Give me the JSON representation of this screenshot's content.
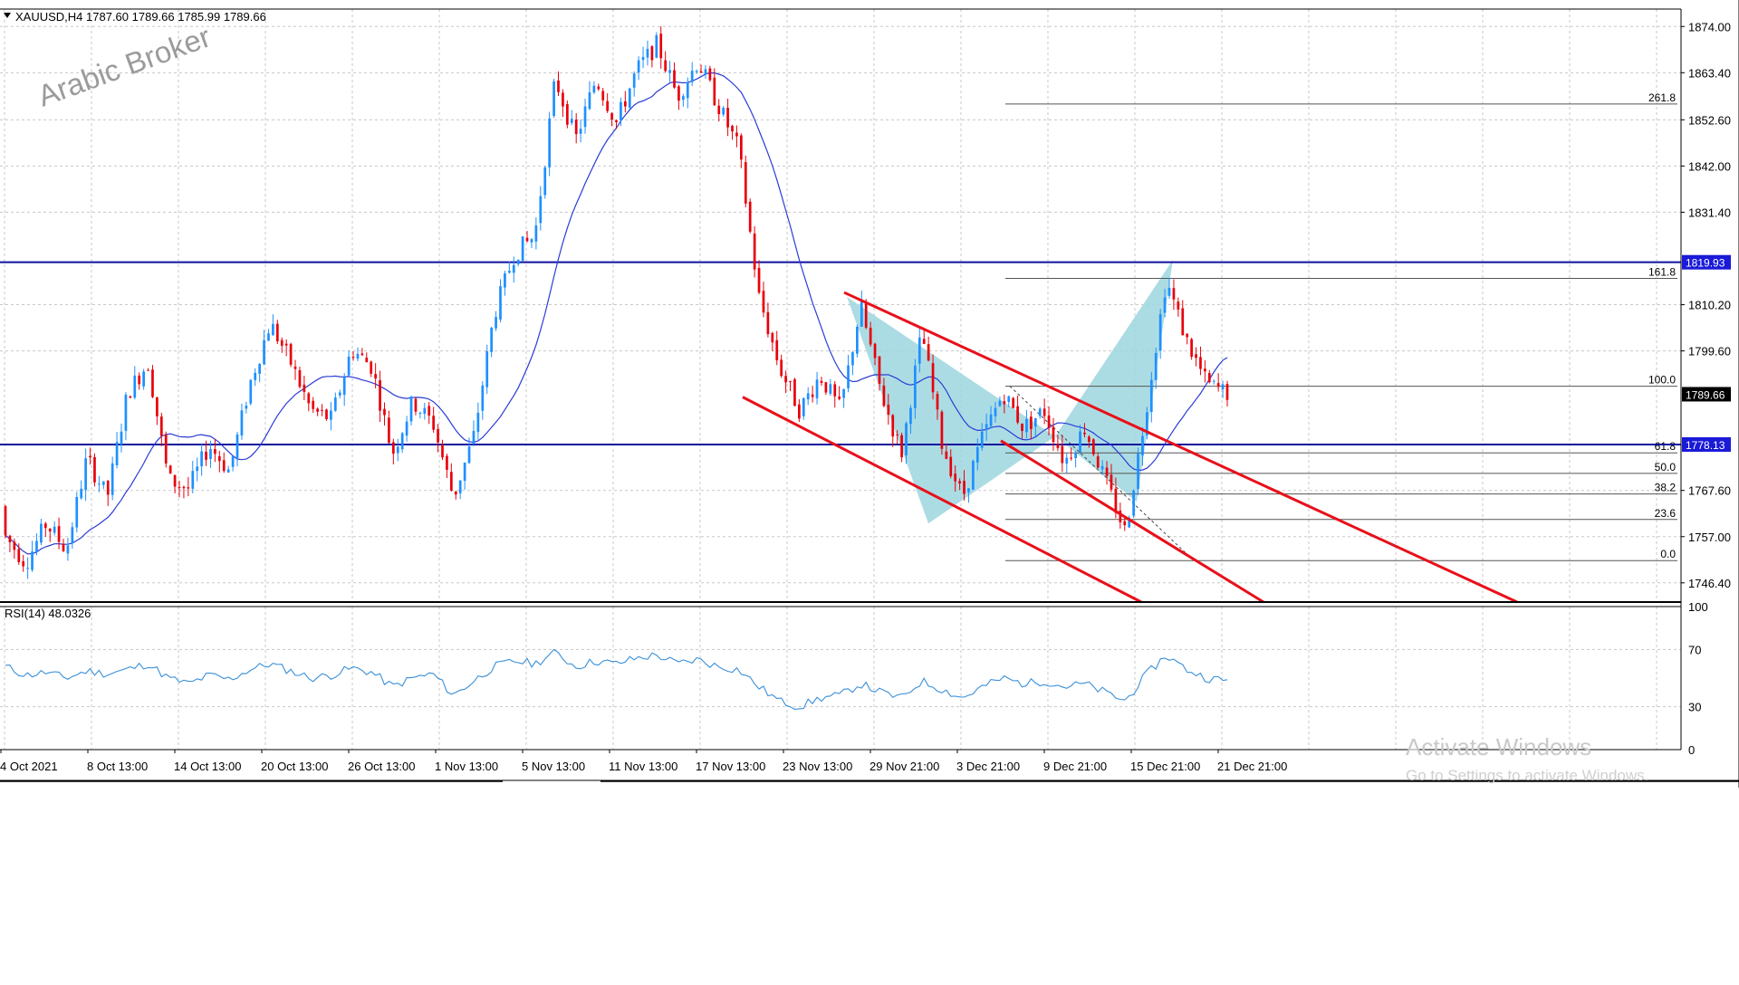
{
  "header": {
    "symbol_line": "XAUUSD,H4  1787.60 1789.66 1785.99 1789.66",
    "watermark": "Arabic Broker"
  },
  "rsi_label": "RSI(14) 48.0326",
  "activation": {
    "line1": "Activate Windows",
    "line2": "Go to Settings to activate Windows."
  },
  "colors": {
    "bull": "#1e90ff",
    "bear": "#e8000b",
    "ma": "#2b3cd6",
    "channel": "#e8101a",
    "hline": "#1010a0",
    "pattern": "#9ed6de",
    "grid": "#c8c8c8",
    "rsi": "#3a8fd8"
  },
  "chart_data": {
    "type": "candlestick",
    "price_axis": {
      "ylim": [
        1742,
        1878
      ],
      "ticks": [
        "1874.00",
        "1863.40",
        "1852.60",
        "1842.00",
        "1831.40",
        "1810.20",
        "1799.60",
        "1767.60",
        "1757.00",
        "1746.40"
      ]
    },
    "x_tick_labels": [
      "4 Oct 2021",
      "8 Oct 13:00",
      "14 Oct 13:00",
      "20 Oct 13:00",
      "26 Oct 13:00",
      "1 Nov 13:00",
      "5 Nov 13:00",
      "11 Nov 13:00",
      "17 Nov 13:00",
      "23 Nov 13:00",
      "29 Nov 21:00",
      "3 Dec 21:00",
      "9 Dec 21:00",
      "15 Dec 21:00",
      "21 Dec 21:00"
    ],
    "price_tags": [
      {
        "value": 1819.93,
        "label": "1819.93",
        "style": "blue"
      },
      {
        "value": 1789.66,
        "label": "1789.66",
        "style": "black"
      },
      {
        "value": 1778.13,
        "label": "1778.13",
        "style": "blue"
      }
    ],
    "horizontal_lines": [
      1819.93,
      1778.13
    ],
    "fibonacci": {
      "low": 1751.5,
      "high": 1791.5,
      "levels": [
        {
          "ratio": 0.0,
          "label": "0.0"
        },
        {
          "ratio": 0.236,
          "label": "23.6"
        },
        {
          "ratio": 0.382,
          "label": "38.2"
        },
        {
          "ratio": 0.5,
          "label": "50.0"
        },
        {
          "ratio": 0.618,
          "label": "61.8"
        },
        {
          "ratio": 1.0,
          "label": "100.0"
        },
        {
          "ratio": 1.618,
          "label": "161.8"
        },
        {
          "ratio": 2.618,
          "label": "261.8"
        }
      ]
    },
    "ohlc_anchors": [
      [
        1764,
        1768,
        1752,
        1757
      ],
      [
        1757,
        1770,
        1746,
        1751
      ],
      [
        1751,
        1765,
        1748,
        1760
      ],
      [
        1760,
        1768,
        1752,
        1754
      ],
      [
        1754,
        1778,
        1750,
        1775
      ],
      [
        1775,
        1786,
        1762,
        1766
      ],
      [
        1766,
        1794,
        1762,
        1790
      ],
      [
        1790,
        1800,
        1784,
        1797
      ],
      [
        1797,
        1799,
        1766,
        1770
      ],
      [
        1770,
        1776,
        1760,
        1768
      ],
      [
        1768,
        1782,
        1764,
        1778
      ],
      [
        1778,
        1784,
        1768,
        1772
      ],
      [
        1772,
        1795,
        1770,
        1792
      ],
      [
        1792,
        1809,
        1786,
        1806
      ],
      [
        1806,
        1811,
        1794,
        1797
      ],
      [
        1797,
        1801,
        1782,
        1786
      ],
      [
        1786,
        1790,
        1780,
        1784
      ],
      [
        1784,
        1805,
        1782,
        1800
      ],
      [
        1800,
        1809,
        1792,
        1796
      ],
      [
        1796,
        1798,
        1772,
        1776
      ],
      [
        1776,
        1791,
        1770,
        1788
      ],
      [
        1788,
        1794,
        1780,
        1783
      ],
      [
        1783,
        1786,
        1762,
        1766
      ],
      [
        1766,
        1784,
        1760,
        1780
      ],
      [
        1780,
        1812,
        1778,
        1808
      ],
      [
        1808,
        1826,
        1804,
        1822
      ],
      [
        1822,
        1830,
        1812,
        1826
      ],
      [
        1826,
        1866,
        1822,
        1862
      ],
      [
        1862,
        1866,
        1842,
        1848
      ],
      [
        1848,
        1866,
        1844,
        1862
      ],
      [
        1862,
        1866,
        1846,
        1852
      ],
      [
        1852,
        1866,
        1848,
        1864
      ],
      [
        1864,
        1876,
        1856,
        1870
      ],
      [
        1870,
        1878,
        1852,
        1858
      ],
      [
        1858,
        1870,
        1850,
        1866
      ],
      [
        1866,
        1868,
        1852,
        1856
      ],
      [
        1856,
        1860,
        1842,
        1846
      ],
      [
        1846,
        1850,
        1808,
        1812
      ],
      [
        1812,
        1816,
        1792,
        1796
      ],
      [
        1796,
        1800,
        1782,
        1786
      ],
      [
        1786,
        1796,
        1780,
        1794
      ],
      [
        1794,
        1798,
        1782,
        1786
      ],
      [
        1786,
        1814,
        1784,
        1810
      ],
      [
        1810,
        1812,
        1786,
        1790
      ],
      [
        1790,
        1794,
        1772,
        1776
      ],
      [
        1776,
        1808,
        1772,
        1804
      ],
      [
        1804,
        1806,
        1774,
        1778
      ],
      [
        1778,
        1782,
        1762,
        1766
      ],
      [
        1766,
        1784,
        1762,
        1780
      ],
      [
        1780,
        1794,
        1776,
        1790
      ],
      [
        1790,
        1794,
        1778,
        1782
      ],
      [
        1782,
        1790,
        1776,
        1786
      ],
      [
        1786,
        1792,
        1770,
        1774
      ],
      [
        1774,
        1786,
        1770,
        1782
      ],
      [
        1782,
        1786,
        1766,
        1770
      ],
      [
        1770,
        1774,
        1752,
        1758
      ],
      [
        1758,
        1790,
        1754,
        1786
      ],
      [
        1786,
        1820,
        1782,
        1816
      ],
      [
        1816,
        1818,
        1798,
        1802
      ],
      [
        1802,
        1804,
        1788,
        1792
      ],
      [
        1792,
        1796,
        1786,
        1790
      ]
    ],
    "rsi": {
      "ylim": [
        0,
        100
      ],
      "ticks": [
        "100",
        "70",
        "30",
        "0"
      ],
      "last": 48.0326,
      "anchors": [
        58,
        52,
        54,
        50,
        55,
        53,
        56,
        60,
        50,
        46,
        52,
        49,
        56,
        60,
        55,
        50,
        52,
        57,
        54,
        44,
        50,
        53,
        38,
        48,
        58,
        62,
        60,
        68,
        58,
        62,
        60,
        64,
        66,
        60,
        63,
        58,
        56,
        44,
        34,
        30,
        36,
        38,
        46,
        40,
        36,
        48,
        42,
        36,
        44,
        50,
        46,
        48,
        44,
        46,
        40,
        34,
        52,
        66,
        56,
        50,
        48
      ]
    }
  }
}
